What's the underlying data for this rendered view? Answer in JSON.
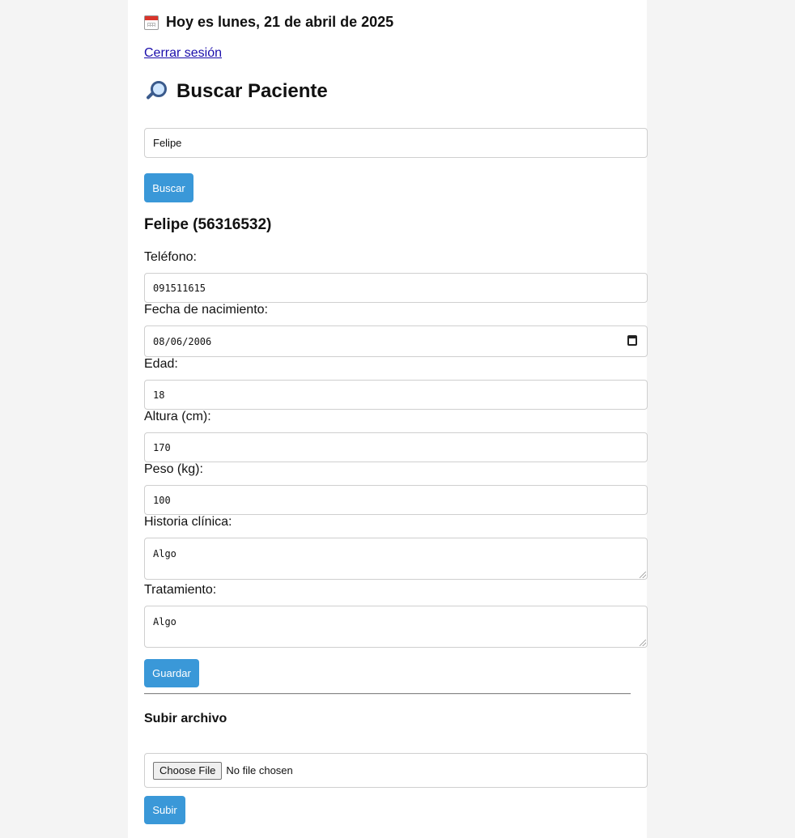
{
  "header": {
    "date_text": "Hoy es lunes, 21 de abril de 2025",
    "logout_label": "Cerrar sesión"
  },
  "search": {
    "title": "Buscar Paciente",
    "query_value": "Felipe",
    "button_label": "Buscar"
  },
  "patient": {
    "heading": "Felipe (56316532)",
    "fields": {
      "telefono": {
        "label": "Teléfono:",
        "value": "091511615"
      },
      "nacimiento": {
        "label": "Fecha de nacimiento:",
        "value": "08/06/2006"
      },
      "edad": {
        "label": "Edad:",
        "value": "18"
      },
      "altura": {
        "label": "Altura (cm):",
        "value": "170"
      },
      "peso": {
        "label": "Peso (kg):",
        "value": "100"
      },
      "historia": {
        "label": "Historia clínica:",
        "value": "Algo"
      },
      "tratamiento": {
        "label": "Tratamiento:",
        "value": "Algo"
      }
    },
    "save_label": "Guardar"
  },
  "upload": {
    "title": "Subir archivo",
    "choose_label": "Choose File",
    "no_file_text": "No file chosen",
    "button_label": "Subir"
  },
  "icons": {
    "date": "calendar-icon",
    "search": "magnifier-icon",
    "date_picker": "calendar-picker-icon"
  },
  "colors": {
    "accent_button": "#3a98d8",
    "link": "#1a0dab",
    "page_background": "#f4f4f4"
  }
}
